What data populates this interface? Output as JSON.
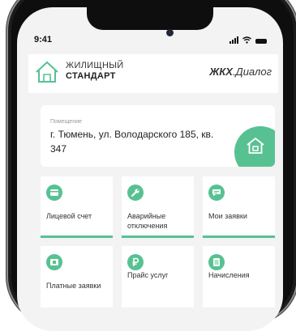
{
  "status_bar": {
    "time": "9:41"
  },
  "header": {
    "brand_top": "ЖИЛИЩНЫЙ",
    "brand_bottom": "СТАНДАРТ",
    "app_bold": "ЖКХ",
    "app_rest": ".Диалог"
  },
  "address": {
    "label": "Помещение",
    "text": "г. Тюмень, ул. Володарского 185, кв. 347"
  },
  "tiles": [
    {
      "label": "Лицевой счет",
      "icon": "card-icon",
      "active": true
    },
    {
      "label": "Аварийные отключения",
      "icon": "wrench-icon",
      "active": true
    },
    {
      "label": "Мои заявки",
      "icon": "chat-icon",
      "active": true
    },
    {
      "label": "Платные заявки",
      "icon": "paid-request-icon",
      "active": false
    },
    {
      "label": "Прайс услуг",
      "icon": "ruble-icon",
      "active": false
    },
    {
      "label": "Начисления",
      "icon": "list-icon",
      "active": false
    }
  ],
  "colors": {
    "accent": "#57c192",
    "screen_bg": "#f2f3f2",
    "frame": "#1c1c1e"
  }
}
